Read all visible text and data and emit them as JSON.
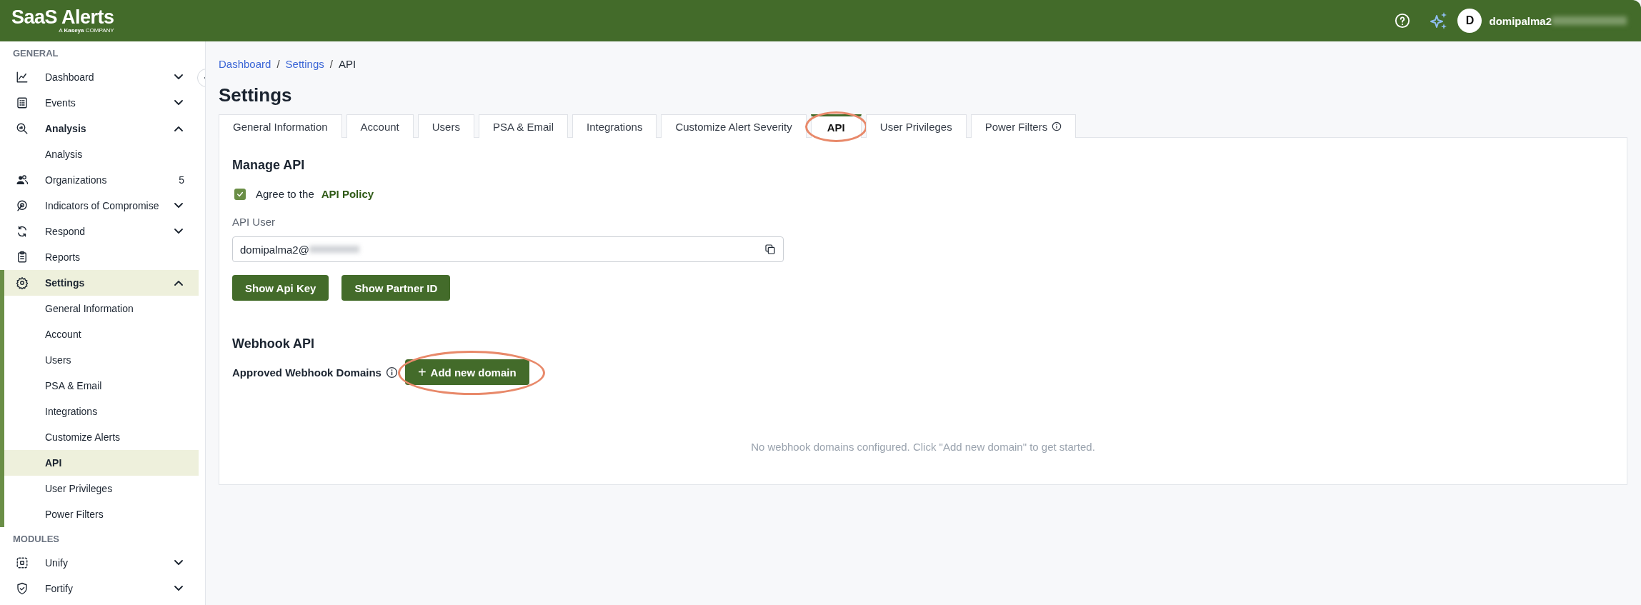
{
  "header": {
    "logo": "SaaS Alerts",
    "tagline": "A **Kaseya** COMPANY",
    "avatar": "D",
    "user": "domipalma2"
  },
  "sidebar": {
    "sections": [
      {
        "title": "GENERAL",
        "items": [
          {
            "label": "Dashboard",
            "expanded": false,
            "selected": false
          },
          {
            "label": "Events",
            "expanded": false,
            "selected": false
          },
          {
            "label": "Analysis",
            "expanded": true,
            "selected": false,
            "children": [
              {
                "label": "Analysis",
                "selected": false
              }
            ]
          },
          {
            "label": "Organizations",
            "count": "5",
            "selected": false
          },
          {
            "label": "Indicators of Compromise",
            "expanded": false,
            "selected": false
          },
          {
            "label": "Respond",
            "expanded": false,
            "selected": false
          },
          {
            "label": "Reports",
            "selected": false
          },
          {
            "label": "Settings",
            "expanded": true,
            "selected": true,
            "children": [
              {
                "label": "General Information",
                "selected": false
              },
              {
                "label": "Account",
                "selected": false
              },
              {
                "label": "Users",
                "selected": false
              },
              {
                "label": "PSA & Email",
                "selected": false
              },
              {
                "label": "Integrations",
                "selected": false
              },
              {
                "label": "Customize Alerts",
                "selected": false
              },
              {
                "label": "API",
                "selected": true
              },
              {
                "label": "User Privileges",
                "selected": false
              },
              {
                "label": "Power Filters",
                "selected": false
              }
            ]
          }
        ]
      },
      {
        "title": "MODULES",
        "items": [
          {
            "label": "Unify",
            "expanded": false,
            "selected": false
          },
          {
            "label": "Fortify",
            "expanded": false,
            "selected": false
          }
        ]
      }
    ]
  },
  "breadcrumb": [
    {
      "label": "Dashboard",
      "kind": "link"
    },
    {
      "label": "/",
      "kind": "separator"
    },
    {
      "label": "Settings",
      "kind": "link"
    },
    {
      "label": "/",
      "kind": "separator"
    },
    {
      "label": "API",
      "kind": "current"
    }
  ],
  "page_title": "Settings",
  "tabs": [
    {
      "label": "General Information",
      "selected": false,
      "highlighted": false
    },
    {
      "label": "Account",
      "selected": false,
      "highlighted": false
    },
    {
      "label": "Users",
      "selected": false,
      "highlighted": false
    },
    {
      "label": "PSA & Email",
      "selected": false,
      "highlighted": false
    },
    {
      "label": "Integrations",
      "selected": false,
      "highlighted": false
    },
    {
      "label": "Customize Alert Severity",
      "selected": false,
      "highlighted": false
    },
    {
      "label": "API",
      "selected": true,
      "highlighted": true
    },
    {
      "label": "User Privileges",
      "selected": false,
      "highlighted": false
    },
    {
      "label": "Power Filters",
      "selected": false,
      "highlighted": false,
      "info": true
    }
  ],
  "manage_api": {
    "title": "Manage API",
    "agree_checked": true,
    "agree_text": "Agree to the",
    "policy_link": "API Policy",
    "api_user_label": "API User",
    "api_user_value": "domipalma2@",
    "buttons": [
      "Show Api Key",
      "Show Partner ID"
    ]
  },
  "webhook_api": {
    "title": "Webhook API",
    "domains_label": "Approved Webhook Domains",
    "add_button": {
      "icon": "+",
      "label": "Add new domain",
      "highlighted": true
    },
    "empty_message": "No webhook domains configured. Click \"Add new domain\" to get started."
  }
}
